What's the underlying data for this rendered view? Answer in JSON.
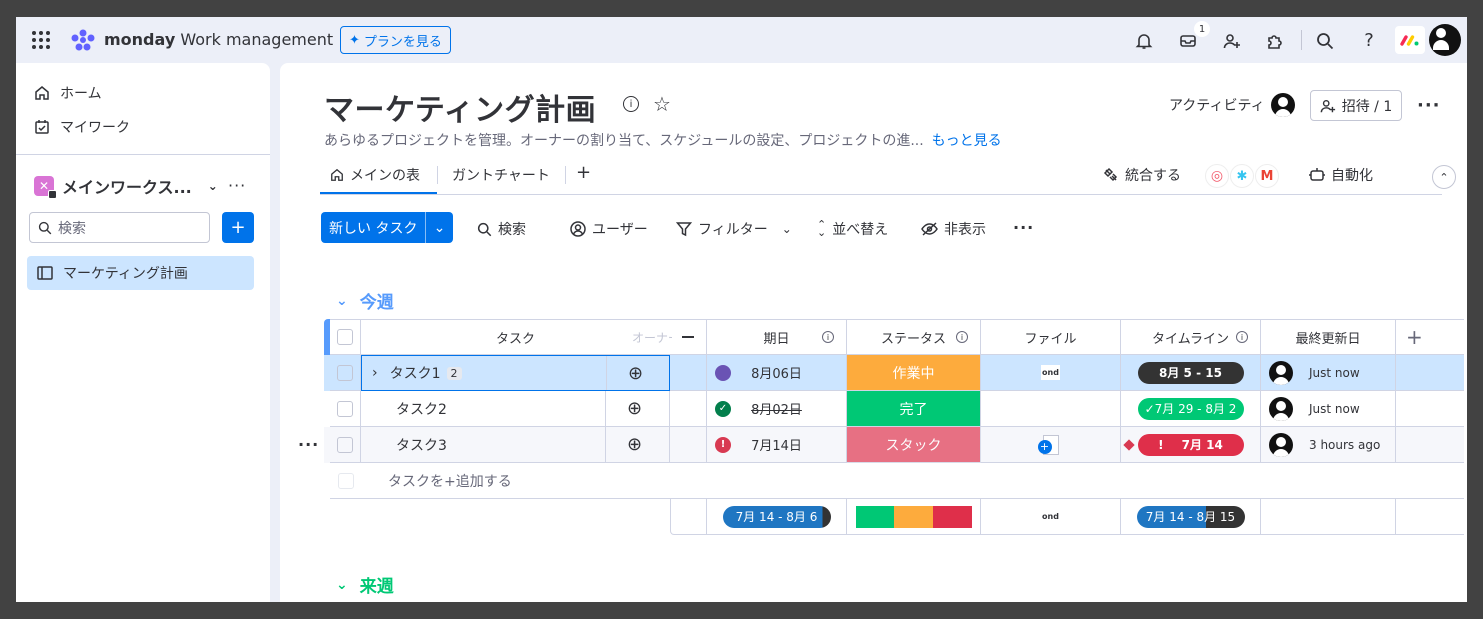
{
  "topbar": {
    "logo_brand": "monday",
    "logo_product": "Work management",
    "plan_button": "プランを見る",
    "inbox_badge": "1"
  },
  "sidebar": {
    "items": [
      {
        "label": "ホーム"
      },
      {
        "label": "マイワーク"
      }
    ],
    "workspace_name": "メインワークス...",
    "search_placeholder": "検索",
    "board_item": "マーケティング計画"
  },
  "board": {
    "title": "マーケティング計画",
    "description": "あらゆるプロジェクトを管理。オーナーの割り当て、スケジュールの設定、プロジェクトの進...",
    "see_more": "もっと見る",
    "activity_label": "アクティビティ",
    "invite_label": "招待 / 1",
    "tabs": [
      {
        "label": "メインの表"
      },
      {
        "label": "ガントチャート"
      }
    ],
    "integrate_label": "統合する",
    "automate_label": "自動化",
    "new_task_label": "新しい タスク",
    "toolbar": {
      "search": "検索",
      "user": "ユーザー",
      "filter": "フィルター",
      "sort": "並べ替え",
      "hide": "非表示"
    }
  },
  "group1": {
    "title": "今週",
    "color": "#579bfc",
    "columns": {
      "task": "タスク",
      "owner": "オーナー",
      "date": "期日",
      "status": "ステータス",
      "file": "ファイル",
      "timeline": "タイムライン",
      "updated": "最終更新日"
    },
    "rows": [
      {
        "name": "タスク1",
        "subitems": "2",
        "date": "8月06日",
        "status": "作業中",
        "status_color": "#fdab3d",
        "timeline": "8月 5 - 15",
        "timeline_color": "#333333",
        "updated": "Just now",
        "file": "ond"
      },
      {
        "name": "タスク2",
        "date": "8月02日",
        "status": "完了",
        "status_color": "#00c875",
        "timeline": "7月 29 - 8月 2",
        "timeline_color": "#00c875",
        "updated": "Just now"
      },
      {
        "name": "タスク3",
        "date": "7月14日",
        "status": "スタック",
        "status_color": "#df2f4a",
        "timeline": "7月 14",
        "timeline_color": "#df2f4a",
        "updated": "3 hours ago"
      }
    ],
    "add_task": "タスクを+追加する",
    "summary": {
      "date_range": "7月 14 - 8月 6",
      "timeline_range": "7月 14 - 8月 15",
      "file": "ond"
    }
  },
  "group2": {
    "title": "来週",
    "color": "#00c875"
  }
}
